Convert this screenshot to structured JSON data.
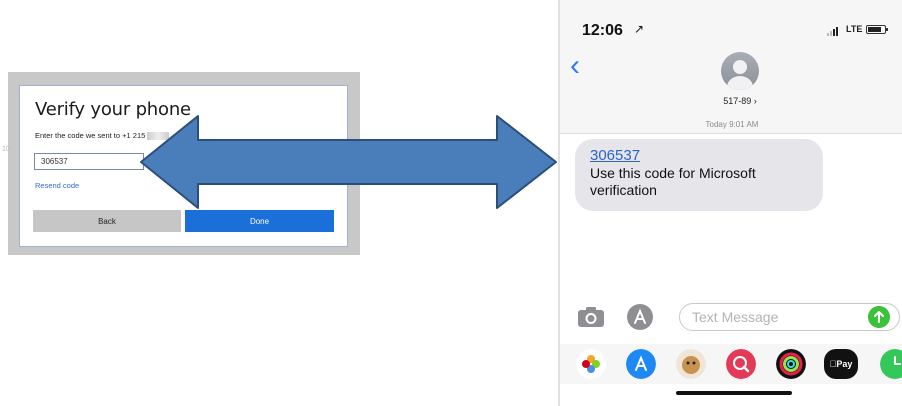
{
  "dialog": {
    "title": "Verify your phone",
    "subtitle": "Enter the code we sent to +1 215",
    "code_value": "306537",
    "resend_label": "Resend code",
    "back_label": "Back",
    "done_label": "Done",
    "bg_stub": "10"
  },
  "phone": {
    "time": "12:06",
    "location_glyph": "↗",
    "network": "LTE",
    "back_glyph": "‹",
    "contact": "517-89 ›",
    "timestamp": "Today 9:01 AM",
    "message_code": "306537",
    "message_text": "Use this code for Microsoft verification",
    "input_placeholder": "Text Message",
    "pay_label": "Pay"
  },
  "icons": [
    "arrow-icon",
    "camera-icon",
    "appstore-icon",
    "send-icon",
    "photos-app-icon",
    "memoji-icon",
    "search-app-icon",
    "fitness-app-icon",
    "applepay-icon",
    "clock-app-icon"
  ],
  "colors": {
    "arrow_fill": "#4a7ebb",
    "arrow_stroke": "#2c4f79",
    "done_button": "#1a6fd8",
    "link": "#2a64c8",
    "ios_blue": "#2f7cf6",
    "send_green": "#3cc13b",
    "bubble_gray": "#e6e6ea"
  }
}
